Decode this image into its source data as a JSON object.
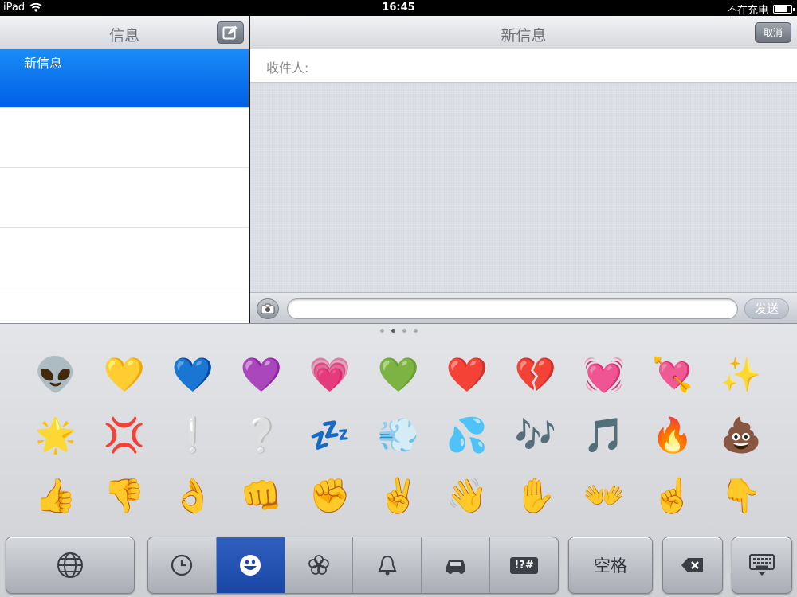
{
  "status_bar": {
    "carrier": "iPad",
    "time": "16:45",
    "battery_text": "不在充电"
  },
  "left_pane": {
    "title": "信息",
    "compose_icon": "compose-icon",
    "selected_item": "新信息"
  },
  "right_pane": {
    "title": "新信息",
    "cancel_label": "取消",
    "to_label": "收件人:",
    "send_label": "发送",
    "camera_icon": "camera-icon"
  },
  "keyboard": {
    "page_count": 4,
    "active_page": 2,
    "emoji": [
      "👽",
      "💛",
      "💙",
      "💜",
      "💗",
      "💚",
      "❤️",
      "💔",
      "💓",
      "💘",
      "✨",
      "🌟",
      "💢",
      "❕",
      "❔",
      "💤",
      "💨",
      "💦",
      "🎶",
      "🎵",
      "🔥",
      "💩",
      "👍",
      "👎",
      "👌",
      "👊",
      "✊",
      "✌️",
      "👋",
      "✋",
      "👐",
      "☝️",
      "👇"
    ],
    "categories": [
      {
        "name": "recent",
        "icon": "clock-icon",
        "active": false
      },
      {
        "name": "people",
        "icon": "smiley-icon",
        "active": true
      },
      {
        "name": "nature",
        "icon": "flower-icon",
        "active": false
      },
      {
        "name": "objects",
        "icon": "bell-icon",
        "active": false
      },
      {
        "name": "places",
        "icon": "car-icon",
        "active": false
      },
      {
        "name": "symbols",
        "icon": "symbols-icon",
        "active": false
      }
    ],
    "symbols_label": "!?#",
    "space_label": "空格",
    "globe_icon": "globe-icon",
    "delete_icon": "delete-icon",
    "dismiss_icon": "keyboard-dismiss-icon",
    "active_color": "#1a47a6",
    "selected_row_color": "#0a6df0"
  }
}
